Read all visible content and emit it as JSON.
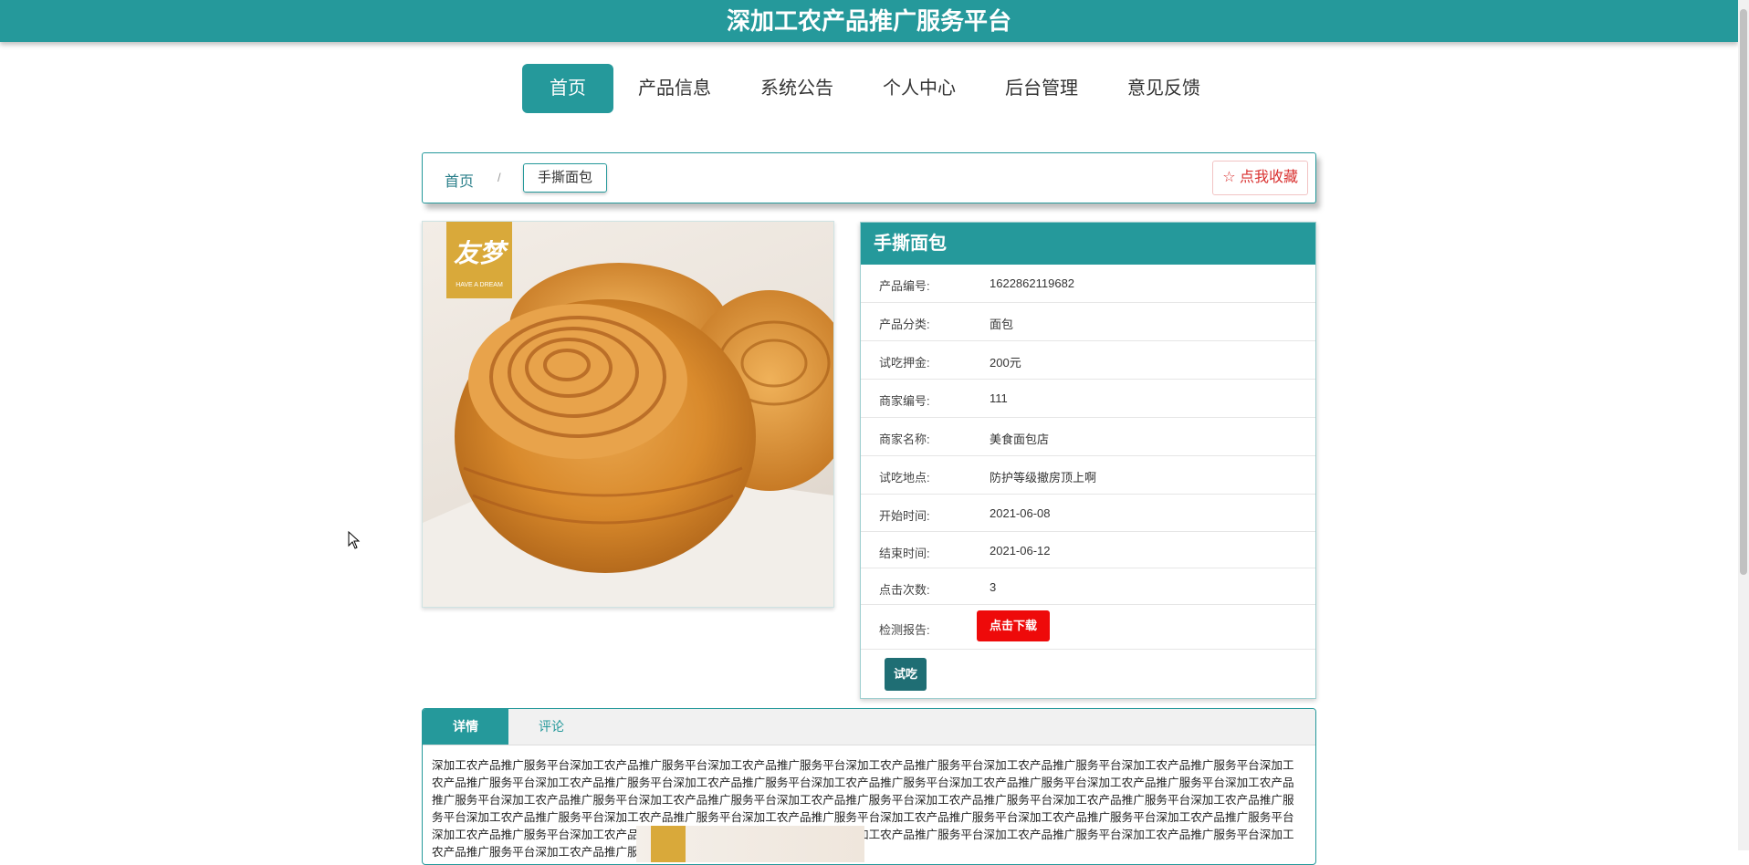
{
  "header": {
    "title": "深加工农产品推广服务平台"
  },
  "nav": {
    "items": [
      "首页",
      "产品信息",
      "系统公告",
      "个人中心",
      "后台管理",
      "意见反馈"
    ],
    "active_index": 0
  },
  "breadcrumb": {
    "home": "首页",
    "separator": "/",
    "current": "手撕面包",
    "favorite_label": "☆ 点我收藏"
  },
  "product_image": {
    "logo_text": "友梦",
    "logo_subtext": "HAVE A DREAM"
  },
  "product": {
    "name": "手撕面包",
    "fields": [
      {
        "label": "产品编号:",
        "value": "1622862119682"
      },
      {
        "label": "产品分类:",
        "value": "面包"
      },
      {
        "label": "试吃押金:",
        "value": "200元"
      },
      {
        "label": "商家编号:",
        "value": "111"
      },
      {
        "label": "商家名称:",
        "value": "美食面包店"
      },
      {
        "label": "试吃地点:",
        "value": "防护等级撤房顶上啊"
      },
      {
        "label": "开始时间:",
        "value": "2021-06-08"
      },
      {
        "label": "结束时间:",
        "value": "2021-06-12"
      },
      {
        "label": "点击次数:",
        "value": "3"
      }
    ],
    "report_label": "检测报告:",
    "download_label": "点击下载",
    "trial_label": "试吃"
  },
  "tabs": {
    "items": [
      "详情",
      "评论"
    ],
    "active_index": 0,
    "detail_text": "深加工农产品推广服务平台深加工农产品推广服务平台深加工农产品推广服务平台深加工农产品推广服务平台深加工农产品推广服务平台深加工农产品推广服务平台深加工农产品推广服务平台深加工农产品推广服务平台深加工农产品推广服务平台深加工农产品推广服务平台深加工农产品推广服务平台深加工农产品推广服务平台深加工农产品推广服务平台深加工农产品推广服务平台深加工农产品推广服务平台深加工农产品推广服务平台深加工农产品推广服务平台深加工农产品推广服务平台深加工农产品推广服务平台深加工农产品推广服务平台深加工农产品推广服务平台深加工农产品推广服务平台深加工农产品推广服务平台深加工农产品推广服务平台深加工农产品推广服务平台深加工农产品推广服务平台深加工农产品推广服务平台深加工农产品推广服务平台深加工农产品推广服务平台深加工农产品推广服务平台深加工农产品推广服务平台深加工农产品推广服务平台深加工农产品推广服务平台"
  },
  "colors": {
    "primary": "#25999b",
    "dark_teal": "#1f6e74",
    "danger": "#ee0a0a"
  }
}
